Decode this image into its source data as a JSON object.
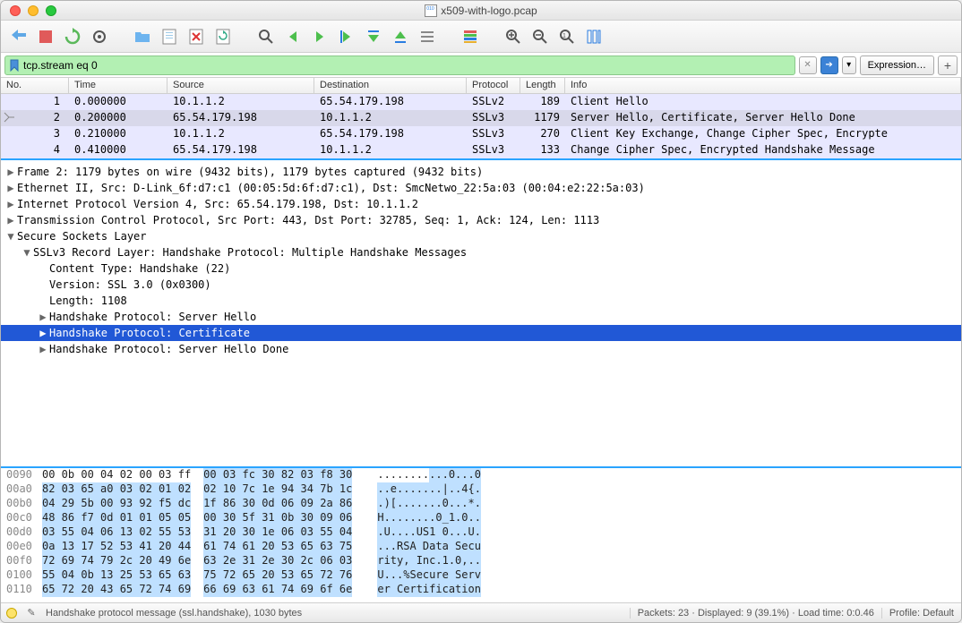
{
  "window_title": "x509-with-logo.pcap",
  "filter": {
    "value": "tcp.stream eq 0",
    "expression_label": "Expression…"
  },
  "packet_columns": [
    "No.",
    "Time",
    "Source",
    "Destination",
    "Protocol",
    "Length",
    "Info"
  ],
  "packets": [
    {
      "no": "1",
      "time": "0.000000",
      "src": "10.1.1.2",
      "dst": "65.54.179.198",
      "proto": "SSLv2",
      "len": "189",
      "info": "Client Hello",
      "selected": false
    },
    {
      "no": "2",
      "time": "0.200000",
      "src": "65.54.179.198",
      "dst": "10.1.1.2",
      "proto": "SSLv3",
      "len": "1179",
      "info": "Server Hello, Certificate, Server Hello Done",
      "selected": true
    },
    {
      "no": "3",
      "time": "0.210000",
      "src": "10.1.1.2",
      "dst": "65.54.179.198",
      "proto": "SSLv3",
      "len": "270",
      "info": "Client Key Exchange, Change Cipher Spec, Encrypte",
      "selected": false
    },
    {
      "no": "4",
      "time": "0.410000",
      "src": "65.54.179.198",
      "dst": "10.1.1.2",
      "proto": "SSLv3",
      "len": "133",
      "info": "Change Cipher Spec, Encrypted Handshake Message",
      "selected": false
    }
  ],
  "details": [
    {
      "ind": 0,
      "arr": "▶",
      "text": "Frame 2: 1179 bytes on wire (9432 bits), 1179 bytes captured (9432 bits)",
      "sel": false
    },
    {
      "ind": 0,
      "arr": "▶",
      "text": "Ethernet II, Src: D-Link_6f:d7:c1 (00:05:5d:6f:d7:c1), Dst: SmcNetwo_22:5a:03 (00:04:e2:22:5a:03)",
      "sel": false
    },
    {
      "ind": 0,
      "arr": "▶",
      "text": "Internet Protocol Version 4, Src: 65.54.179.198, Dst: 10.1.1.2",
      "sel": false
    },
    {
      "ind": 0,
      "arr": "▶",
      "text": "Transmission Control Protocol, Src Port: 443, Dst Port: 32785, Seq: 1, Ack: 124, Len: 1113",
      "sel": false
    },
    {
      "ind": 0,
      "arr": "▼",
      "text": "Secure Sockets Layer",
      "sel": false
    },
    {
      "ind": 1,
      "arr": "▼",
      "text": "SSLv3 Record Layer: Handshake Protocol: Multiple Handshake Messages",
      "sel": false
    },
    {
      "ind": 2,
      "arr": "",
      "text": "Content Type: Handshake (22)",
      "sel": false
    },
    {
      "ind": 2,
      "arr": "",
      "text": "Version: SSL 3.0 (0x0300)",
      "sel": false
    },
    {
      "ind": 2,
      "arr": "",
      "text": "Length: 1108",
      "sel": false
    },
    {
      "ind": 2,
      "arr": "▶",
      "text": "Handshake Protocol: Server Hello",
      "sel": false
    },
    {
      "ind": 2,
      "arr": "▶",
      "text": "Handshake Protocol: Certificate",
      "sel": true
    },
    {
      "ind": 2,
      "arr": "▶",
      "text": "Handshake Protocol: Server Hello Done",
      "sel": false
    }
  ],
  "hex": [
    {
      "off": "0090",
      "b1": "00 0b 00 04 02 00 03 ff",
      "b2": "00 03 fc 30 82 03 f8 30",
      "a1": "........",
      "a2": "...0...0",
      "hl_b1": false,
      "hl_b2": true,
      "hl_a2": true
    },
    {
      "off": "00a0",
      "b1": "82 03 65 a0 03 02 01 02",
      "b2": "02 10 7c 1e 94 34 7b 1c",
      "a1": "..e.....",
      "a2": "..|..4{.",
      "hl_b1": true,
      "hl_b2": true,
      "hl_a1": true,
      "hl_a2": true
    },
    {
      "off": "00b0",
      "b1": "04 29 5b 00 93 92 f5 dc",
      "b2": "1f 86 30 0d 06 09 2a 86",
      "a1": ".)[.....",
      "a2": "..0...*.",
      "hl_b1": true,
      "hl_b2": true,
      "hl_a1": true,
      "hl_a2": true
    },
    {
      "off": "00c0",
      "b1": "48 86 f7 0d 01 01 05 05",
      "b2": "00 30 5f 31 0b 30 09 06",
      "a1": "H.......",
      "a2": ".0_1.0..",
      "hl_b1": true,
      "hl_b2": true,
      "hl_a1": true,
      "hl_a2": true
    },
    {
      "off": "00d0",
      "b1": "03 55 04 06 13 02 55 53",
      "b2": "31 20 30 1e 06 03 55 04",
      "a1": ".U....US",
      "a2": "1 0...U.",
      "hl_b1": true,
      "hl_b2": true,
      "hl_a1": true,
      "hl_a2": true
    },
    {
      "off": "00e0",
      "b1": "0a 13 17 52 53 41 20 44",
      "b2": "61 74 61 20 53 65 63 75",
      "a1": "...RSA D",
      "a2": "ata Secu",
      "hl_b1": true,
      "hl_b2": true,
      "hl_a1": true,
      "hl_a2": true
    },
    {
      "off": "00f0",
      "b1": "72 69 74 79 2c 20 49 6e",
      "b2": "63 2e 31 2e 30 2c 06 03",
      "a1": "rity, In",
      "a2": "c.1.0,..",
      "hl_b1": true,
      "hl_b2": true,
      "hl_a1": true,
      "hl_a2": true
    },
    {
      "off": "0100",
      "b1": "55 04 0b 13 25 53 65 63",
      "b2": "75 72 65 20 53 65 72 76",
      "a1": "U...%Sec",
      "a2": "ure Serv",
      "hl_b1": true,
      "hl_b2": true,
      "hl_a1": true,
      "hl_a2": true
    },
    {
      "off": "0110",
      "b1": "65 72 20 43 65 72 74 69",
      "b2": "66 69 63 61 74 69 6f 6e",
      "a1": "er Certi",
      "a2": "fication",
      "hl_b1": true,
      "hl_b2": true,
      "hl_a1": true,
      "hl_a2": true
    }
  ],
  "status": {
    "message": "Handshake protocol message (ssl.handshake), 1030 bytes",
    "right1": "Packets: 23 · Displayed: 9 (39.1%) · Load time: 0:0.46",
    "right2": "Profile: Default"
  }
}
